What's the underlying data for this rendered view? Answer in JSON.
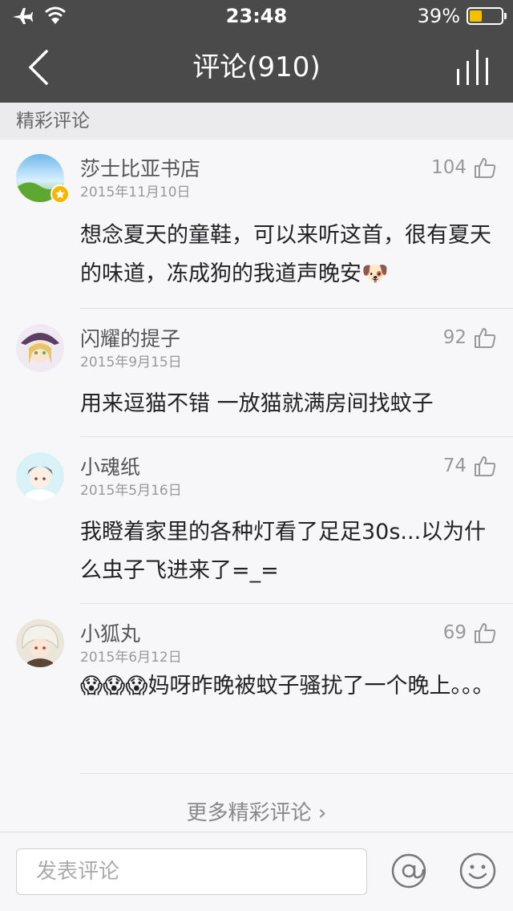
{
  "status_bar": {
    "time": "23:48",
    "battery_text": "39%",
    "battery_level": 0.39,
    "battery_color": "#f5c000"
  },
  "nav": {
    "title": "评论(910)"
  },
  "section": {
    "title": "精彩评论"
  },
  "comments": [
    {
      "name": "莎士比亚书店",
      "date": "2015年11月10日",
      "likes": "104",
      "text": "想念夏天的童鞋，可以来听这首，很有夏天的味道，冻成狗的我道声晚安🐶",
      "vip": true
    },
    {
      "name": "闪耀的提子",
      "date": "2015年9月15日",
      "likes": "92",
      "text": "用来逗猫不错 一放猫就满房间找蚊子"
    },
    {
      "name": "小魂纸",
      "date": "2015年5月16日",
      "likes": "74",
      "text": "我瞪着家里的各种灯看了足足30s...以为什么虫子飞进来了=_="
    },
    {
      "name": "小狐丸",
      "date": "2015年6月12日",
      "likes": "69",
      "text": "😱😱😱妈呀昨晚被蚊子骚扰了一个晚上。。。"
    }
  ],
  "more": {
    "label": "更多精彩评论 ›"
  },
  "input": {
    "placeholder": "发表评论"
  },
  "icons": {
    "airplane": "airplane-icon",
    "wifi": "wifi-icon",
    "back": "back-chevron-icon",
    "stats": "bars-icon",
    "like": "thumbs-up-icon",
    "at": "at-sign-icon",
    "emoji": "smiley-icon",
    "vip": "star-icon"
  },
  "colors": {
    "bar": "#4a4a4a",
    "accent": "#f7b500"
  }
}
